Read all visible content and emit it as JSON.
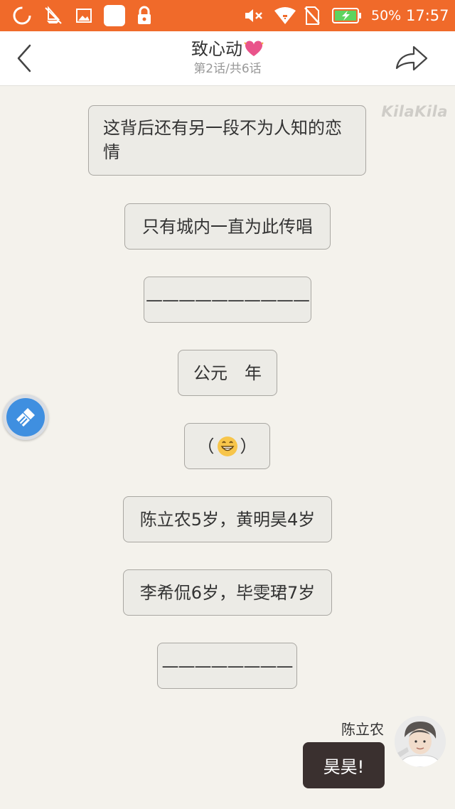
{
  "status_bar": {
    "battery_percent": "50%",
    "time": "17:57",
    "background_color": "#f06a2a",
    "icons": [
      "loading-ring-icon",
      "sailboat-icon",
      "image-icon",
      "blank-app-icon",
      "lock-icon",
      "mute-icon",
      "wifi-icon",
      "no-sim-icon",
      "battery-charging-icon"
    ]
  },
  "header": {
    "title": "致心动",
    "title_icon": "heart-icon",
    "subtitle": "第2话/共6话"
  },
  "watermark": "KilaKila",
  "narration": [
    {
      "text": "这背后还有另一段不为人知的恋情"
    },
    {
      "text": "只有城内一直为此传唱"
    },
    {
      "text": "——————————"
    },
    {
      "text": "公元　年"
    },
    {
      "text_before": "（",
      "emoji": "grinning-face-icon",
      "text_after": "）"
    },
    {
      "text": "陈立农5岁，黄明昊4岁"
    },
    {
      "text": "李希侃6岁，毕雯珺7岁"
    },
    {
      "text": "————————"
    }
  ],
  "message": {
    "speaker": "陈立农",
    "text": "昊昊!",
    "bubble_color": "#3a302f"
  }
}
